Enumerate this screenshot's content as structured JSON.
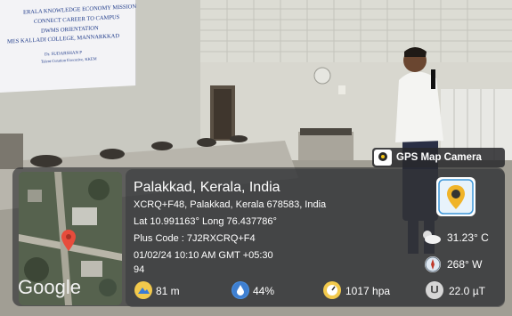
{
  "slide": {
    "lines": [
      "ERALA KNOWLEDGE ECONOMY MISSION",
      "CONNECT CAREER TO CAMPUS",
      "DWMS ORIENTATION",
      "MES KALLADI COLLEGE, MANNARKKAD",
      "Dr. SUDARSHAN P",
      "Talent Curation Executive, KKEM"
    ]
  },
  "badge": {
    "label": "GPS Map Camera"
  },
  "map": {
    "watermark": "Google"
  },
  "location": {
    "title": "Palakkad, Kerala, India",
    "address": "XCRQ+F48, Palakkad, Kerala 678583, India",
    "coords": "Lat 10.991163° Long 76.437786°",
    "plus_code": "Plus Code : 7J2RXCRQ+F4",
    "datetime": "01/02/24 10:10 AM GMT +05:30",
    "extra": "94"
  },
  "stats": {
    "temperature": "31.23° C",
    "wind": "268° W",
    "altitude": "81 m",
    "humidity": "44%",
    "pressure": "1017 hpa",
    "magnetic": "22.0 µT"
  }
}
